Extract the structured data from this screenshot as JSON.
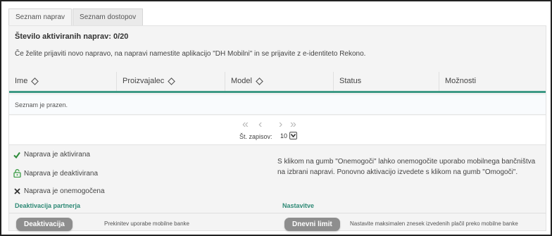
{
  "tabs": [
    {
      "label": "Seznam naprav",
      "active": true
    },
    {
      "label": "Seznam dostopov",
      "active": false
    }
  ],
  "device_count": "Število aktiviranih naprav: 0/20",
  "info_text": "Če želite prijaviti novo napravo, na napravi namestite aplikacijo \"DH Mobilni\" in se prijavite z e-identiteto Rekono.",
  "table": {
    "columns": [
      "Ime",
      "Proizvajalec",
      "Model",
      "Status",
      "Možnosti"
    ],
    "empty_message": "Seznam je prazen."
  },
  "pagination": {
    "first": "«",
    "prev": "‹",
    "next": "›",
    "last": "»",
    "per_page_label": "Št. zapisov:",
    "per_page_value": "10"
  },
  "legend": [
    {
      "icon": "checkmark-icon",
      "label": "Naprava je aktivirana",
      "color": "#2e8b3a"
    },
    {
      "icon": "unlock-icon",
      "label": "Naprava je deaktivirana",
      "color": "#3b9c46"
    },
    {
      "icon": "cross-icon",
      "label": "Naprava je onemogočena",
      "color": "#333333"
    }
  ],
  "legend_note": "S klikom na gumb \"Onemogoči\" lahko onemogočite uporabo mobilnega bančništva na izbrani napravi. Ponovno aktivacijo izvedete s klikom na gumb \"Omogoči\".",
  "sections": {
    "deactivation": {
      "title": "Deaktivacija partnerja",
      "button": "Deaktivacija",
      "description": "Prekinitev uporabe mobilne banke"
    },
    "settings": {
      "title": "Nastavitve",
      "button": "Dnevni limit",
      "description": "Nastavite maksimalen znesek izvedenih plačil preko mobilne banke"
    }
  },
  "colors": {
    "accent": "#3f9a86",
    "section_title": "#2f8a76",
    "button": "#8e8e8e"
  }
}
